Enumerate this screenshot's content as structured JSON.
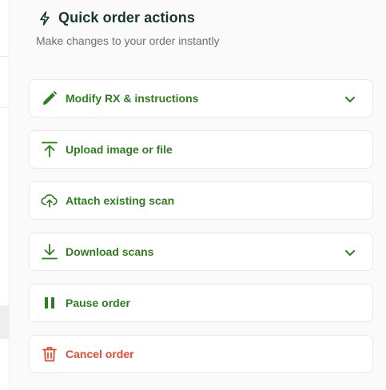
{
  "colors": {
    "accent": "#2e7d1e",
    "danger": "#e44b2f",
    "title": "#163a24",
    "muted": "#6e706e"
  },
  "panel": {
    "title": "Quick order actions",
    "title_icon": "bolt-icon",
    "subtitle": "Make changes to your order instantly"
  },
  "actions": [
    {
      "label": "Modify RX & instructions",
      "icon": "pencil-icon",
      "expandable": true
    },
    {
      "label": "Upload image or file",
      "icon": "upload-icon",
      "expandable": false
    },
    {
      "label": "Attach existing scan",
      "icon": "cloud-upload-icon",
      "expandable": false
    },
    {
      "label": "Download scans",
      "icon": "download-icon",
      "expandable": true
    },
    {
      "label": "Pause order",
      "icon": "pause-icon",
      "expandable": false
    },
    {
      "label": "Cancel order",
      "icon": "trash-icon",
      "expandable": false,
      "danger": true
    }
  ]
}
